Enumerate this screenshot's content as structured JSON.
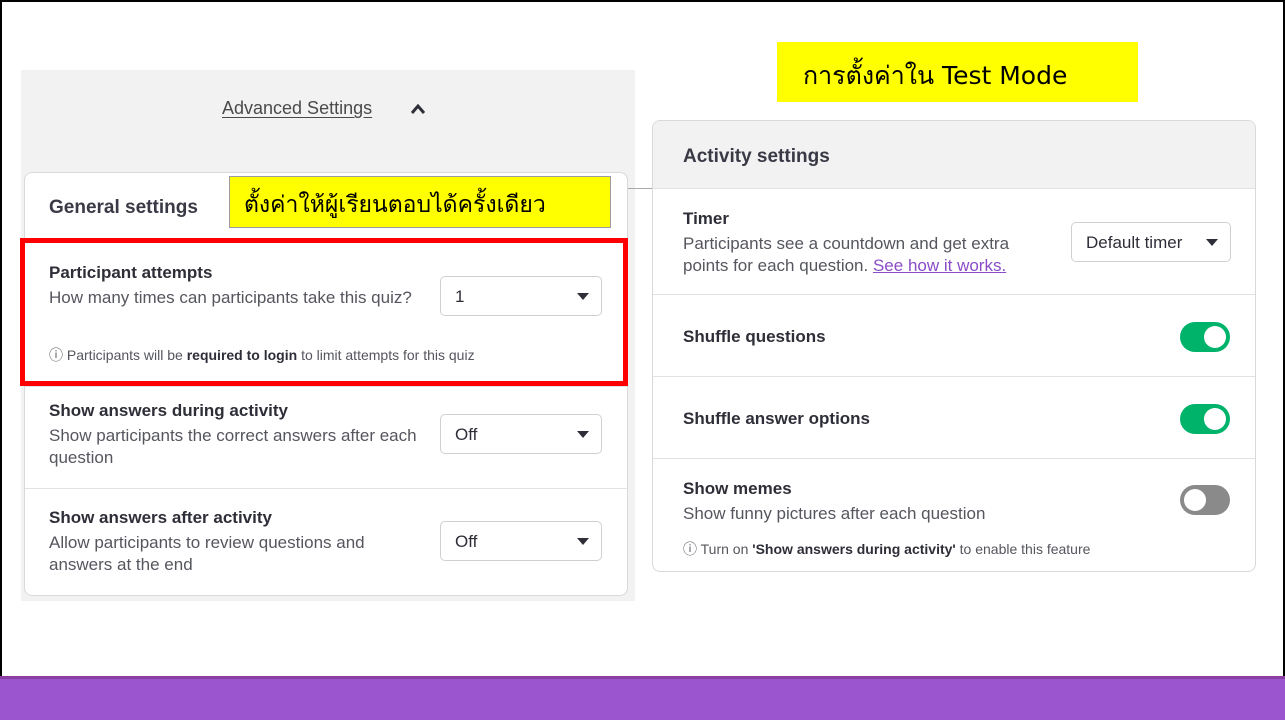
{
  "colors": {
    "accent_green": "#00b36b",
    "highlight_yellow": "#ffff00",
    "alert_red": "#ff0000",
    "footer_purple": "#9a55cf",
    "link_purple": "#8b4cc7"
  },
  "advanced": {
    "link_label": "Advanced Settings",
    "chevron_icon": "chevron-up-icon"
  },
  "general": {
    "title": "General settings",
    "annotation": "ตั้งค่าให้ผู้เรียนตอบได้ครั้งเดียว",
    "attempts": {
      "title": "Participant attempts",
      "description": "How many times can participants take this quiz?",
      "value": "1",
      "note_prefix": "Participants will be",
      "note_bold": "required to login",
      "note_suffix": "to limit attempts for this quiz",
      "note_icon": "info-icon"
    },
    "during": {
      "title": "Show answers during activity",
      "description": "Show participants the correct answers after each question",
      "value": "Off"
    },
    "after": {
      "title": "Show answers after activity",
      "description": "Allow participants to review questions and answers at the end",
      "value": "Off"
    }
  },
  "test_mode_title": "การตั้งค่าใน Test Mode",
  "activity": {
    "title": "Activity settings",
    "timer": {
      "title": "Timer",
      "description_line1": "Participants see a countdown and get extra",
      "description_line2": "points for each question.",
      "link": "See how it works.",
      "value": "Default timer"
    },
    "shuffle_questions": {
      "title": "Shuffle questions",
      "enabled": true
    },
    "shuffle_answers": {
      "title": "Shuffle answer options",
      "enabled": true
    },
    "memes": {
      "title": "Show memes",
      "description": "Show funny pictures after each question",
      "enabled": false,
      "note_prefix": "Turn on",
      "note_bold": "'Show answers during activity'",
      "note_suffix": "to enable this feature",
      "note_icon": "info-icon"
    }
  }
}
